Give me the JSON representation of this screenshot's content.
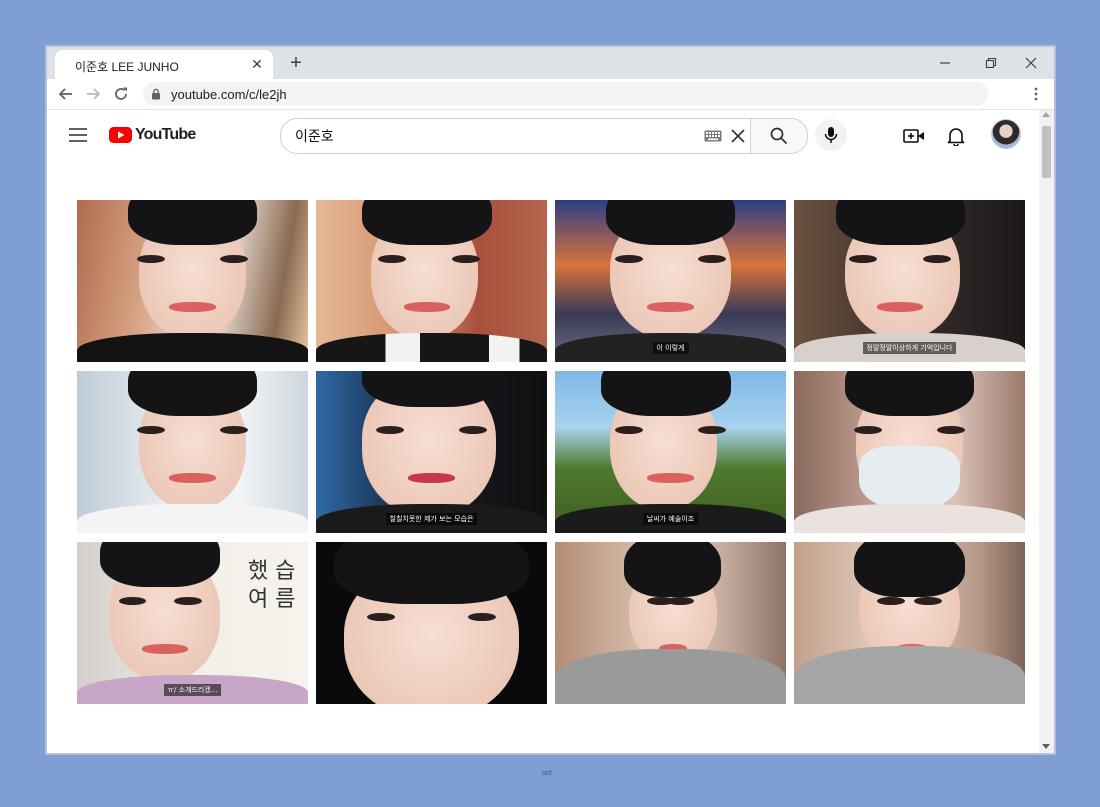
{
  "browser": {
    "tab_title": "이준호 LEE JUNHO",
    "tab_close": "✕",
    "new_tab": "+",
    "url": "youtube.com/c/le2jh"
  },
  "youtube": {
    "logo_text": "YouTube",
    "search_value": "이준호",
    "brand_color": "#ff0000",
    "icons": [
      "menu-icon",
      "keyboard-icon",
      "clear-icon",
      "search-icon",
      "mic-icon",
      "create-video-icon",
      "bell-icon"
    ]
  },
  "grid": {
    "thumbnails": [
      {
        "caption": "",
        "variant": "black-turtleneck-cafe"
      },
      {
        "caption": "",
        "variant": "brick-wall-jacket"
      },
      {
        "caption": "이 이렇게",
        "variant": "carousel-night"
      },
      {
        "caption": "정말정말이상하게 기억입니다",
        "variant": "dark-restaurant"
      },
      {
        "caption": "",
        "variant": "white-shirt-closeup"
      },
      {
        "caption": "칠칠치못한 제가 보는 모습은",
        "variant": "low-angle-selfie"
      },
      {
        "caption": "날씨가 예술이죠",
        "variant": "outdoor-forest"
      },
      {
        "caption": "",
        "variant": "face-mask"
      },
      {
        "caption": "ㅠ/ 소개드리겠...",
        "variant": "korean-text-wall"
      },
      {
        "caption": "",
        "variant": "dark-bangs"
      },
      {
        "caption": "",
        "variant": "grey-hoodie-room"
      },
      {
        "caption": "",
        "variant": "grey-hoodie-closeup"
      }
    ]
  },
  "watermark": "oct"
}
